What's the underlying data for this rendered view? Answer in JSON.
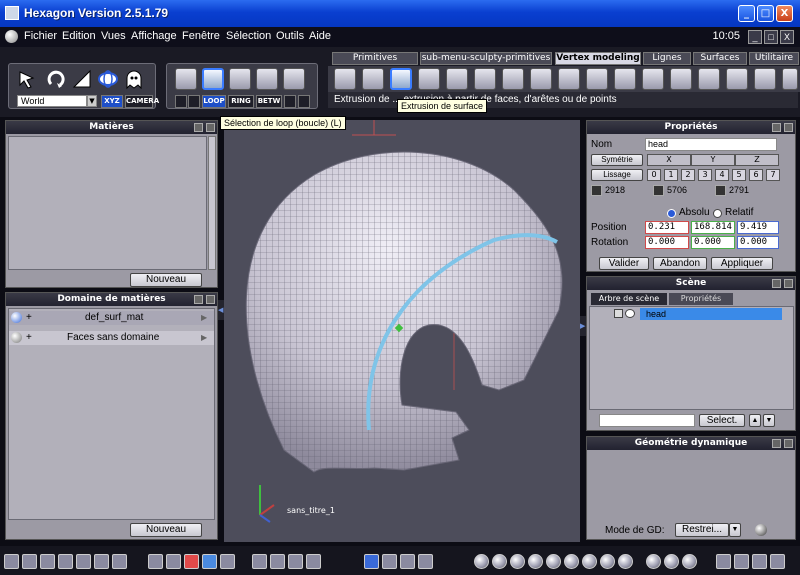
{
  "window": {
    "title": "Hexagon Version 2.5.1.79",
    "min_label": "_",
    "max_label": "□",
    "close_label": "X"
  },
  "menu": {
    "items": [
      "Fichier",
      "Edition",
      "Vues",
      "Affichage",
      "Fenêtre",
      "Sélection",
      "Outils",
      "Aide"
    ],
    "clock": "10:05",
    "mdi_min": "_",
    "mdi_restore": "□",
    "mdi_close": "X"
  },
  "toolbar": {
    "coord_space": "World",
    "xyz_label": "XYZ",
    "camera_label": "CAMERA",
    "select_modes": [
      "LOOP",
      "RING",
      "BETW"
    ],
    "tabs": [
      "Primitives",
      "sub-menu-sculpty-primitives",
      "Vertex modeling",
      "Lignes",
      "Surfaces",
      "Utilitaire"
    ],
    "active_tab": "Vertex modeling",
    "extrusion_line": "Extrusion de ... extrusion à partir de faces, d'arêtes ou de points",
    "tooltip_extrusion": "Extrusion de surface",
    "tooltip_loop": "Sélection de loop (boucle) (L)"
  },
  "matieres": {
    "title": "Matières",
    "button": "Nouveau"
  },
  "domaine": {
    "title": "Domaine de matières",
    "rows": [
      {
        "plus": "+",
        "label": "def_surf_mat"
      },
      {
        "plus": "+",
        "label": "Faces sans domaine"
      }
    ],
    "button": "Nouveau"
  },
  "viewport": {
    "name": "sans_titre_1"
  },
  "proprietes": {
    "title": "Propriétés",
    "nom_label": "Nom",
    "nom_value": "head",
    "symetrie_label": "Symétrie",
    "axes": [
      "X",
      "Y",
      "Z"
    ],
    "lissage_label": "Lissage",
    "lissage_levels": [
      "0",
      "1",
      "2",
      "3",
      "4",
      "5",
      "6",
      "7"
    ],
    "counts": [
      "2918",
      "5706",
      "2791"
    ],
    "absolu_label": "Absolu",
    "relatif_label": "Relatif",
    "position_label": "Position",
    "position": [
      "0.231",
      "168.814",
      "9.419"
    ],
    "rotation_label": "Rotation",
    "rotation": [
      "0.000",
      "0.000",
      "0.000"
    ],
    "valider": "Valider",
    "abandon": "Abandon",
    "appliquer": "Appliquer"
  },
  "scene": {
    "title": "Scène",
    "tabs": [
      "Arbre de scène",
      "Propriétés"
    ],
    "items": [
      "head"
    ],
    "select_button": "Select."
  },
  "geometrie": {
    "title": "Géométrie dynamique",
    "mode_label": "Mode de GD:",
    "mode_value": "Restrei..."
  }
}
